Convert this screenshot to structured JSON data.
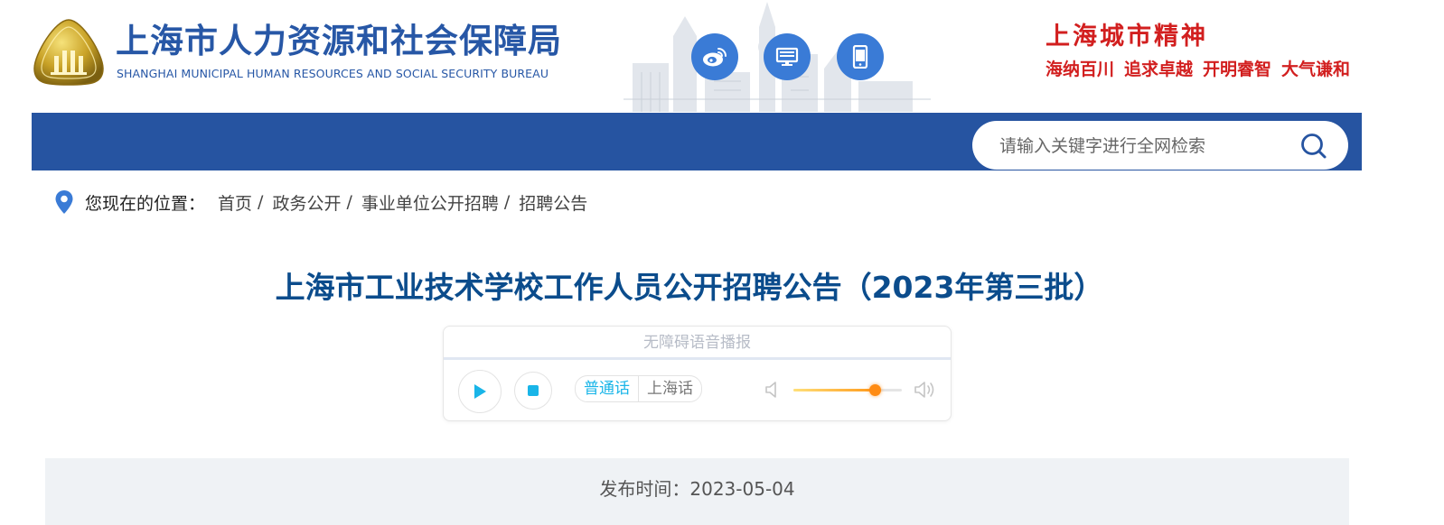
{
  "header": {
    "org_name_cn": "上海市人力资源和社会保障局",
    "org_name_en": "SHANGHAI MUNICIPAL HUMAN RESOURCES AND SOCIAL SECURITY BUREAU",
    "icons": [
      "weibo-icon",
      "desktop-icon",
      "mobile-icon"
    ],
    "slogan_title": "上海城市精神",
    "slogan_items": [
      "海纳百川",
      "追求卓越",
      "开明睿智",
      "大气谦和"
    ],
    "colors": {
      "brand_blue": "#2757a6",
      "slogan_red": "#d21f1f"
    }
  },
  "nav": {
    "color": "#2654a1",
    "search_placeholder": "请输入关键字进行全网检索"
  },
  "breadcrumb": {
    "label": "您现在的位置：",
    "items": [
      "首页",
      "政务公开",
      "事业单位公开招聘",
      "招聘公告"
    ],
    "separator": "/"
  },
  "article": {
    "title": "上海市工业技术学校工作人员公开招聘公告（2023年第三批）",
    "title_color": "#0b4c8c"
  },
  "player": {
    "title": "无障碍语音播报",
    "languages": [
      "普通话",
      "上海话"
    ],
    "active_language": "普通话",
    "accent": "#19b5e8",
    "volume_percent": 75,
    "progress_percent": 0
  },
  "publish": {
    "label": "发布时间：",
    "date": "2023-05-04"
  }
}
